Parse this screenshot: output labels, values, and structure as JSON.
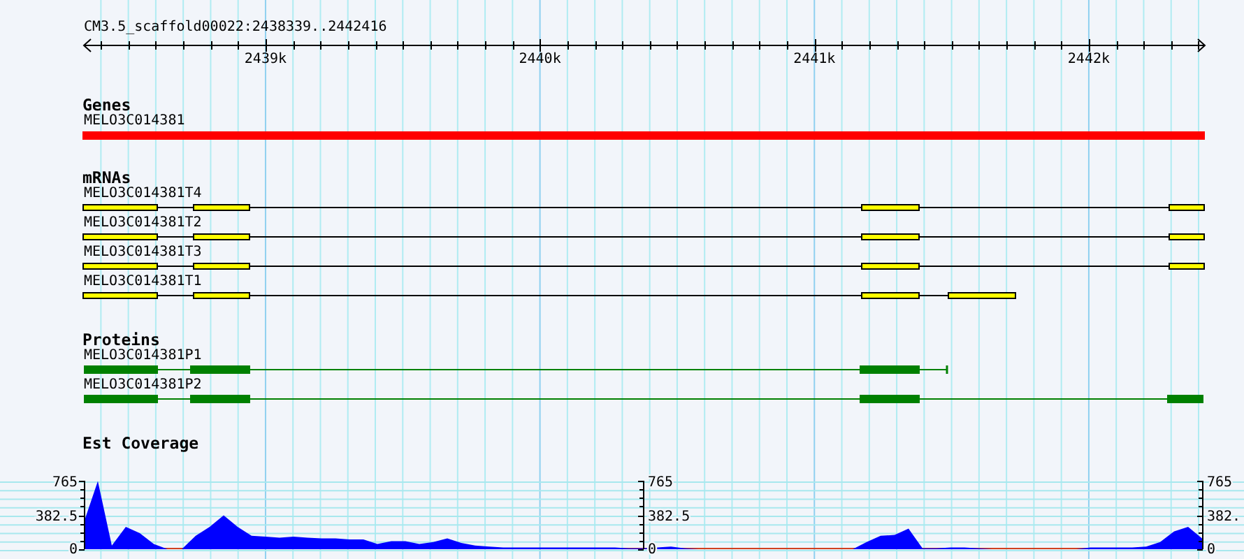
{
  "region": "CM3.5_scaffold00022:2438339..2442416",
  "ruler": {
    "ticks": [
      "2439k",
      "2440k",
      "2441k",
      "2442k"
    ]
  },
  "tracks": {
    "genes": {
      "title": "Genes",
      "features": [
        {
          "name": "MELO3C014381"
        }
      ]
    },
    "mrnas": {
      "title": "mRNAs",
      "features": [
        {
          "name": "MELO3C014381T4"
        },
        {
          "name": "MELO3C014381T2"
        },
        {
          "name": "MELO3C014381T3"
        },
        {
          "name": "MELO3C014381T1"
        }
      ]
    },
    "proteins": {
      "title": "Proteins",
      "features": [
        {
          "name": "MELO3C014381P1"
        },
        {
          "name": "MELO3C014381P2"
        }
      ]
    },
    "coverage": {
      "title": "Est Coverage",
      "axes": [
        {
          "labels": [
            "765",
            "382.5",
            "0"
          ]
        },
        {
          "labels": [
            "765",
            "382.5",
            "0"
          ]
        },
        {
          "labels": [
            "765",
            "382.",
            "0"
          ]
        }
      ],
      "chart_data": {
        "type": "area",
        "ylim": [
          0,
          765
        ],
        "yticks": [
          0,
          382.5,
          765
        ],
        "series": [
          {
            "color": "#0000ff",
            "values": [
              300,
              760,
              40,
              250,
              180,
              60,
              0,
              0,
              150,
              250,
              380,
              250,
              150,
              140,
              130,
              140,
              130,
              120,
              120,
              110,
              110,
              60,
              90,
              90,
              60,
              80,
              120,
              70,
              40,
              30,
              20,
              20,
              20,
              20,
              20,
              20,
              20,
              20,
              20,
              10,
              10,
              20,
              30,
              10,
              0,
              0,
              0,
              0,
              0,
              0,
              0,
              0,
              0,
              0,
              0,
              0,
              80,
              150,
              160,
              230,
              10,
              10,
              20,
              20,
              10,
              0,
              0,
              0,
              0,
              0,
              0,
              0,
              20,
              20,
              20,
              20,
              30,
              80,
              200,
              250,
              120
            ]
          }
        ]
      }
    }
  }
}
